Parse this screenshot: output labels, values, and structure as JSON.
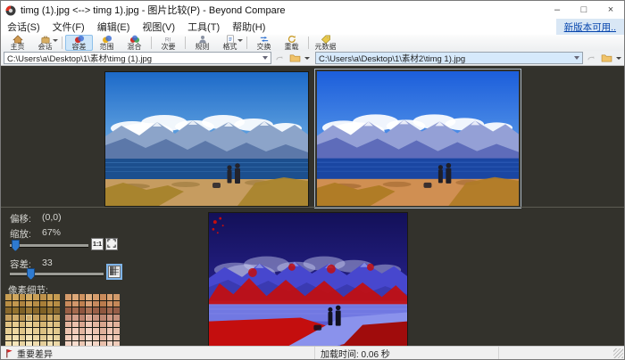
{
  "window": {
    "title": "timg (1).jpg <--> timg 1).jpg - 图片比较(P) - Beyond Compare",
    "controls": {
      "minimize": "–",
      "maximize": "□",
      "close": "×"
    }
  },
  "menu": {
    "items": [
      "会话(S)",
      "文件(F)",
      "编辑(E)",
      "视图(V)",
      "工具(T)",
      "帮助(H)"
    ],
    "update_link": "新版本可用.."
  },
  "toolbar": {
    "groups": [
      [
        {
          "label": "主页",
          "icon": "home"
        },
        {
          "label": "会话",
          "icon": "session",
          "dropdown": true
        }
      ],
      [
        {
          "label": "容差",
          "icon": "tolerance",
          "active": true
        },
        {
          "label": "范围",
          "icon": "range"
        },
        {
          "label": "混合",
          "icon": "blend"
        }
      ],
      [
        {
          "label": "次要",
          "icon": "secondary"
        }
      ],
      [
        {
          "label": "规则",
          "icon": "rules"
        },
        {
          "label": "格式",
          "icon": "format",
          "dropdown": true
        }
      ],
      [
        {
          "label": "交换",
          "icon": "swap"
        },
        {
          "label": "重载",
          "icon": "reload"
        }
      ],
      [
        {
          "label": "元数据",
          "icon": "metadata"
        }
      ]
    ]
  },
  "paths": {
    "left": "C:\\Users\\a\\Desktop\\1\\素材\\timg (1).jpg",
    "right": "C:\\Users\\a\\Desktop\\1\\素材2\\timg 1).jpg"
  },
  "panel": {
    "offset_label": "偏移:",
    "offset_value": "(0,0)",
    "zoom_label": "缩放:",
    "zoom_value": "67%",
    "zoom_slider_pct": 2,
    "btn_one_to_one": "1:1",
    "tolerance_label": "容差:",
    "tolerance_value": "33",
    "tolerance_slider_pct": 22,
    "pixels_label": "像素细节:"
  },
  "status": {
    "diff_label": "重要差异",
    "load_time": "加载时间: 0.06 秒"
  },
  "colors": {
    "accent": "#2e7ad0",
    "selection": "#cfe6f9",
    "flag": "#d42020",
    "dark_bg": "#33322c"
  },
  "pixel_grids": {
    "left": [
      [
        "#c79d52",
        "#d1a75e",
        "#c2954b",
        "#d4ac64",
        "#c99f56",
        "#bd914a",
        "#cba158",
        "#c59a50"
      ],
      [
        "#b98e44",
        "#c3984f",
        "#ad833f",
        "#c99e56",
        "#b78d45",
        "#a97f38",
        "#c1964e",
        "#b78d43"
      ],
      [
        "#8a692d",
        "#947330",
        "#7d6027",
        "#9b7836",
        "#8a692c",
        "#7f6126",
        "#917031",
        "#876830"
      ],
      [
        "#c6a05f",
        "#d0ae6d",
        "#ba9554",
        "#d5b274",
        "#c8a462",
        "#bc9753",
        "#cdaa68",
        "#c3a05e"
      ],
      [
        "#dfc182",
        "#e7cc90",
        "#d7b979",
        "#ead095",
        "#dfc285",
        "#d4b574",
        "#e3c78b",
        "#dbbe80"
      ],
      [
        "#e6cd92",
        "#eed7a0",
        "#dfc488",
        "#f0daa6",
        "#e6cd94",
        "#dbc183",
        "#ead29a",
        "#e2c98e"
      ],
      [
        "#ecd7a2",
        "#f2e0b0",
        "#e5ce97",
        "#f4e3b6",
        "#ecd7a4",
        "#e1ca92",
        "#f0dcab",
        "#e8d39e"
      ],
      [
        "#f0dcab",
        "#f5e5ba",
        "#e9d4a0",
        "#f7e8c0",
        "#f0dcae",
        "#e5cf9a",
        "#f3e2b5",
        "#ecd8a7"
      ]
    ],
    "right": [
      [
        "#d59b6b",
        "#dda879",
        "#cf9260",
        "#e1af81",
        "#d69d6d",
        "#c98b5b",
        "#daa273",
        "#d29a6a"
      ],
      [
        "#c98a5c",
        "#d3976b",
        "#bf7f4f",
        "#d99f75",
        "#c78a5e",
        "#bb7b4d",
        "#cf9266",
        "#c58858"
      ],
      [
        "#9a5f46",
        "#a56b4f",
        "#8e553f",
        "#ab7155",
        "#9a6048",
        "#8f573f",
        "#a26951",
        "#965e48"
      ],
      [
        "#c8907c",
        "#d29e8a",
        "#bc836f",
        "#d9a997",
        "#c89480",
        "#bc8671",
        "#cf9a86",
        "#c48f7b"
      ],
      [
        "#e4b49e",
        "#ecc0ac",
        "#daa791",
        "#f0c8b6",
        "#e4b6a0",
        "#d8a58d",
        "#e9bca8",
        "#e0b09a"
      ],
      [
        "#ecc2ae",
        "#f2ccba",
        "#e2b59f",
        "#f5d2c2",
        "#ecc4b0",
        "#dfb19b",
        "#f0c8b6",
        "#e8bea9"
      ],
      [
        "#f1ccba",
        "#f6d6c6",
        "#e8bfab",
        "#f8dccd",
        "#f1ceba",
        "#e5b8a4",
        "#f4d2c2",
        "#edc6b2"
      ],
      [
        "#f4d4c4",
        "#f8dcce",
        "#ecc7b3",
        "#fae2d5",
        "#f4d6c6",
        "#e9bfab",
        "#f6d8ca",
        "#f0ccba"
      ]
    ],
    "highlight_cell": [
      3,
      3
    ]
  },
  "images": {
    "left_palette": {
      "skyTop": "#1d6ac9",
      "skyMid": "#74b2e6",
      "cloud": "#ffffff",
      "mountFar": "#8ca4c9",
      "mountNear": "#5c78a9",
      "snow": "#eef4fa",
      "lake": "#1c4f8e",
      "lakeLight": "#3e78b8",
      "shore": "#c69c60",
      "shoreDark": "#8f6f33",
      "grass": "#a8842e",
      "figure": "#23232b"
    },
    "right_palette": {
      "skyTop": "#1c5edb",
      "skyMid": "#5e9eea",
      "cloud": "#ffffff",
      "mountFar": "#94a0d6",
      "mountNear": "#5e6cba",
      "snow": "#f2f4fc",
      "lake": "#1a46a2",
      "lakeLight": "#3c6cc6",
      "shore": "#d08f52",
      "shoreDark": "#965f28",
      "grass": "#b07c26",
      "figure": "#1e1e28"
    },
    "diff_palette": {
      "skyTop": "#131058",
      "skyMid": "#28238e",
      "cloud": "#c9cef2",
      "mountFar": "#4747ce",
      "mountNear": "#3a3ab2",
      "snow": "#8a92e2",
      "lake": "#7178e2",
      "lakeLight": "#8a92ec",
      "shore": "#5a5ad2",
      "shoreDark": "#b01010",
      "grass": "#a80d0d",
      "figure": "#10101e",
      "red": "#c40e0e"
    }
  }
}
